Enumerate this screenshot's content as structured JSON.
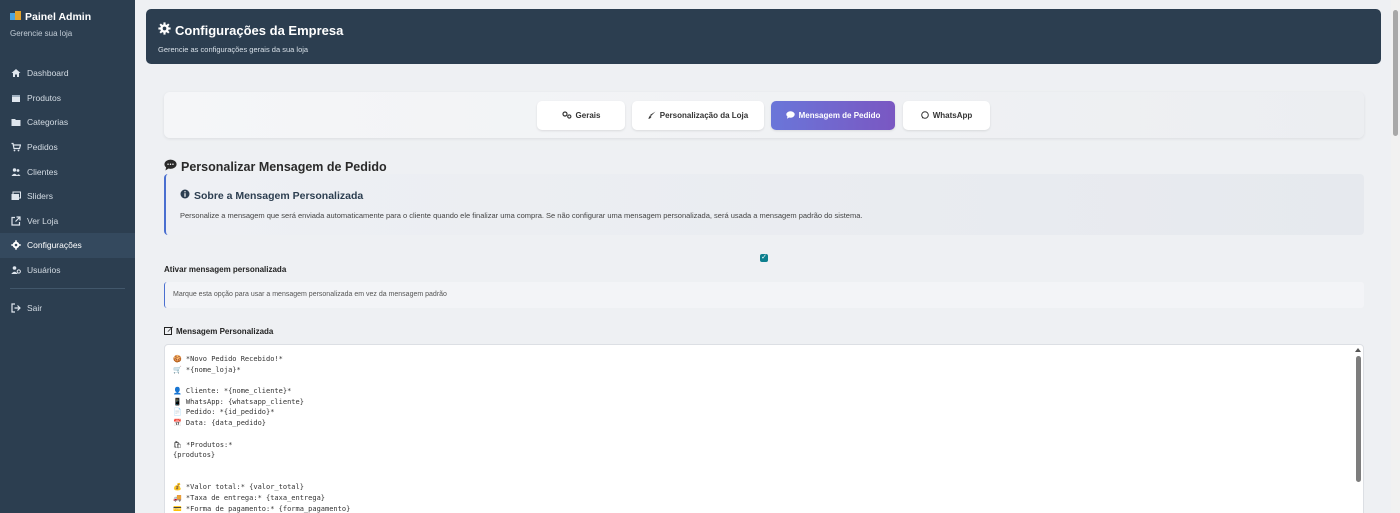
{
  "sidebar": {
    "title": "Painel Admin",
    "subtitle": "Gerencie sua loja",
    "items": [
      {
        "label": "Dashboard",
        "icon": "home-icon"
      },
      {
        "label": "Produtos",
        "icon": "box-icon"
      },
      {
        "label": "Categorias",
        "icon": "folder-icon"
      },
      {
        "label": "Pedidos",
        "icon": "cart-icon"
      },
      {
        "label": "Clientes",
        "icon": "users-icon"
      },
      {
        "label": "Sliders",
        "icon": "images-icon"
      },
      {
        "label": "Ver Loja",
        "icon": "external-link-icon"
      },
      {
        "label": "Configurações",
        "icon": "gear-icon"
      },
      {
        "label": "Usuários",
        "icon": "user-cog-icon"
      },
      {
        "label": "Sair",
        "icon": "logout-icon"
      }
    ]
  },
  "header": {
    "title": "Configurações da Empresa",
    "subtitle": "Gerencie as configurações gerais da sua loja"
  },
  "tabs": [
    {
      "label": "Gerais",
      "icon": "gears-icon"
    },
    {
      "label": "Personalização da Loja",
      "icon": "brush-icon"
    },
    {
      "label": "Mensagem de Pedido",
      "icon": "comment-icon"
    },
    {
      "label": "WhatsApp",
      "icon": "whatsapp-icon"
    }
  ],
  "section": {
    "title": "Personalizar Mensagem de Pedido",
    "info_title": "Sobre a Mensagem Personalizada",
    "info_text": "Personalize a mensagem que será enviada automaticamente para o cliente quando ele finalizar uma compra. Se não configurar uma mensagem personalizada, será usada a mensagem padrão do sistema.",
    "checkbox_label": "Ativar mensagem personalizada",
    "checkbox_checked": true,
    "hint": "Marque esta opção para usar a mensagem personalizada em vez da mensagem padrão",
    "message_label": "Mensagem Personalizada"
  },
  "message_lines": [
    "🍪 *Novo Pedido Recebido!*",
    "🛒 *{nome_loja}*",
    "",
    "👤 Cliente: *{nome_cliente}*",
    "📱 WhatsApp: {whatsapp_cliente}",
    "📄 Pedido: *{id_pedido}*",
    "📅 Data: {data_pedido}",
    "",
    "🛍 *Produtos:*",
    "{produtos}",
    "",
    "",
    "💰 *Valor total:* {valor_total}",
    "🚚 *Taxa de entrega:* {taxa_entrega}",
    "💳 *Forma de pagamento:* {forma_pagamento}"
  ],
  "colors": {
    "sidebar_bg": "#2c3e50",
    "header_bg": "#2c3e50",
    "active_tab_start": "#6a76d9",
    "active_tab_end": "#7a57c2",
    "accent_border": "#4a6fd0",
    "checkbox": "#0d7f8e"
  }
}
